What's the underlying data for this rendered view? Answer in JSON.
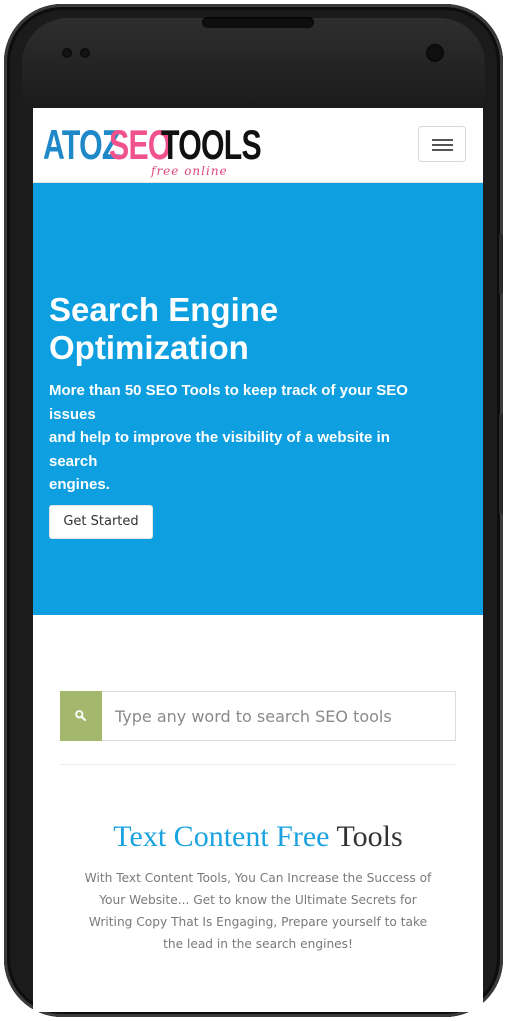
{
  "header": {
    "logo": {
      "part1": "ATOZ",
      "part2": "SEO",
      "part3": "TOOLS",
      "tagline": "free online"
    },
    "menu_icon": "hamburger-menu-icon"
  },
  "hero": {
    "title": "Search Engine Optimization",
    "subtitle_lines": [
      "More than 50 SEO Tools to keep track of your SEO",
      "issues",
      "and help to improve the visibility of a website in",
      "search",
      "engines."
    ],
    "cta_label": "Get Started"
  },
  "search": {
    "placeholder": "Type any word to search SEO tools",
    "value": "",
    "icon": "search-icon"
  },
  "section": {
    "title_accent": "Text Content Free",
    "title_rest": "Tools",
    "description": "With Text Content Tools, You Can Increase the Success of Your Website... Get to know the Ultimate Secrets for Writing Copy That Is Engaging, Prepare yourself to take the lead in the search engines!"
  },
  "colors": {
    "hero_bg": "#0d9fe0",
    "search_button": "#a3b86c",
    "logo_blue": "#1e88c9",
    "logo_pink": "#f0528e",
    "title_accent": "#1aa3e0"
  }
}
